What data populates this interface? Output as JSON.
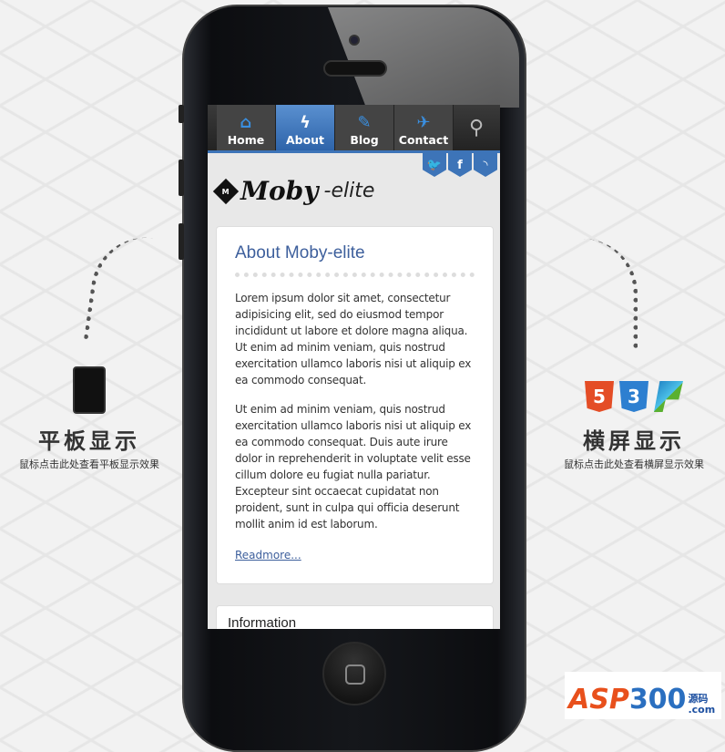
{
  "nav": {
    "items": [
      {
        "label": "Home",
        "icon": "home-icon"
      },
      {
        "label": "About",
        "icon": "lightning-icon",
        "active": true
      },
      {
        "label": "Blog",
        "icon": "pen-icon"
      },
      {
        "label": "Contact",
        "icon": "plane-icon"
      }
    ],
    "search_icon": "search-icon"
  },
  "social": {
    "twitter": "t",
    "facebook": "f",
    "rss": "rss"
  },
  "logo": {
    "mark": "M",
    "name": "Moby",
    "suffix": "-elite"
  },
  "article": {
    "title": "About Moby-elite",
    "p1": "Lorem ipsum dolor sit amet, consectetur adipisicing elit, sed do eiusmod tempor incididunt ut labore et dolore magna aliqua. Ut enim ad minim veniam, quis nostrud exercitation ullamco laboris nisi ut aliquip ex ea commodo consequat.",
    "p2": "Ut enim ad minim veniam, quis nostrud exercitation ullamco laboris nisi ut aliquip ex ea commodo consequat. Duis aute irure dolor in reprehenderit in voluptate velit esse cillum dolore eu fugiat nulla pariatur. Excepteur sint occaecat cupidatat non proident, sunt in culpa qui officia deserunt mollit anim id est laborum.",
    "readmore": "Readmore..."
  },
  "info": {
    "title": "Information"
  },
  "left_promo": {
    "title": "平板显示",
    "subtitle": "鼠标点击此处查看平板显示效果"
  },
  "right_promo": {
    "title": "横屏显示",
    "subtitle": "鼠标点击此处查看横屏显示效果",
    "badges": [
      "5",
      "3",
      ""
    ]
  },
  "watermark": {
    "brand": "ASP",
    "num": "300",
    "cn": "源码",
    "domain": ".com"
  },
  "colors": {
    "accent": "#3d74b8",
    "link": "#3d5f9c"
  }
}
